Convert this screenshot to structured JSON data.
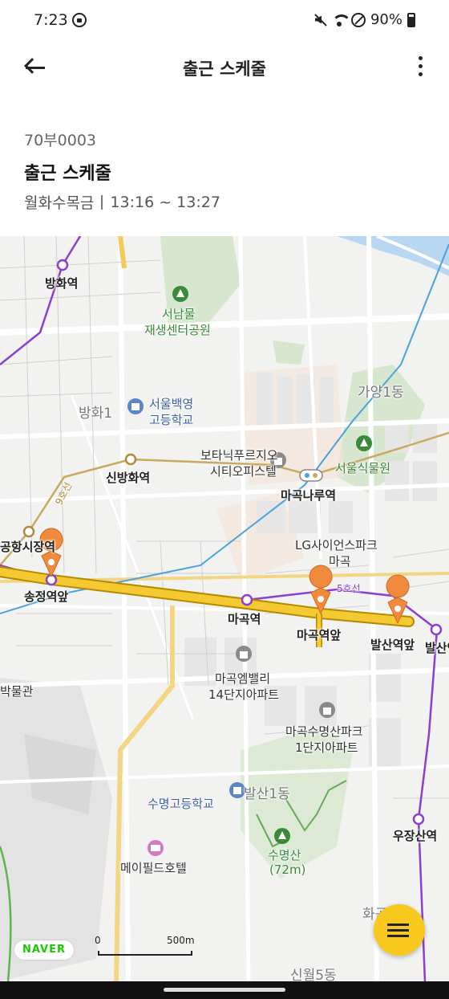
{
  "status_bar": {
    "time": "7:23",
    "battery": "90%",
    "icons": [
      "dnd-icon",
      "mute-icon",
      "wifi-icon",
      "block-icon",
      "battery-icon"
    ]
  },
  "app_bar": {
    "title": "출근 스케줄",
    "back_icon": "arrow-left-icon",
    "more_icon": "more-vertical-icon"
  },
  "schedule": {
    "plate": "70부0003",
    "title": "출근 스케줄",
    "days": "월화수목금",
    "time_range": "13:16 ~ 13:27"
  },
  "map": {
    "labels": {
      "banghwa_station": "방화역",
      "seonammul_line1": "서남물",
      "seonammul_line2": "재생센터공원",
      "gayang": "가양1동",
      "banghwa_dong": "방화1",
      "seoul_school_line1": "서울백영",
      "seoul_school_line2": "고등학교",
      "botanic_line1": "보타닉푸르지오",
      "botanic_line2": "시티오피스텔",
      "sinbanghwa": "신방화역",
      "magoknaru": "마곡나루역",
      "seoul_botanic": "서울식물원",
      "line9": "9호선",
      "airport_market": "공항시장역",
      "lg_line1": "LG사이언스파크",
      "lg_line2": "마곡",
      "line5": "5호선",
      "songjeong": "송정역앞",
      "magok_station": "마곡역",
      "magok_front": "마곡역앞",
      "balsan_front": "발산역앞",
      "balsan_station": "발산역",
      "museum": "박물관",
      "embelly_line1": "마곡엠밸리",
      "embelly_line2": "14단지아파트",
      "suyeongsan_apt_line1": "마곡수명산파크",
      "suyeongsan_apt_line2": "1단지아파트",
      "balsan1": "발산1동",
      "suyeong_school": "수명고등학교",
      "ujangsan": "우장산역",
      "suyeongsan_line1": "수명산",
      "suyeongsan_line2": "(72m)",
      "mayfield": "메이필드호텔",
      "hwagok": "화곡",
      "sinwol": "신월5동"
    },
    "attribution": "NAVER",
    "scale": {
      "zero": "0",
      "max": "500m"
    },
    "colors": {
      "route": "#f4c932",
      "marker": "#f08a3c",
      "line5": "#8b3fd0",
      "line9": "#c9a961",
      "airport_rail": "#4aa3dc",
      "park": "#d6e6cf"
    }
  },
  "fab": {
    "icon": "list-icon"
  }
}
